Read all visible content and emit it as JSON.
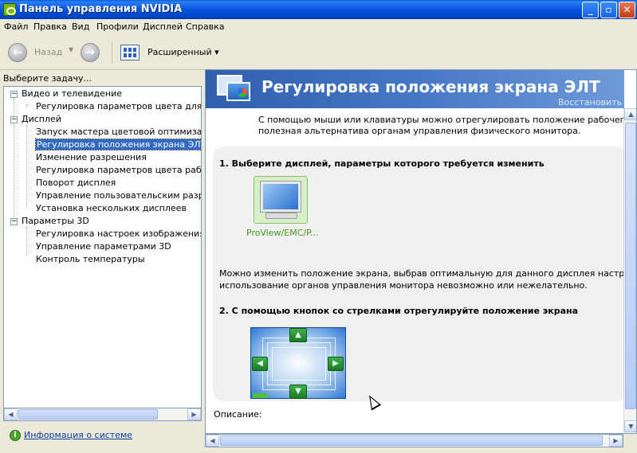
{
  "window": {
    "title": "Панель управления NVIDIA",
    "minimize": "_",
    "maximize": "▫",
    "close": "✕"
  },
  "menu": [
    "Файл",
    "Правка",
    "Вид",
    "Профили",
    "Дисплей",
    "Справка"
  ],
  "toolbar": {
    "back_label": "Назад",
    "view_label": "Расширенный"
  },
  "left": {
    "task_heading": "Выберите задачу...",
    "tree": {
      "video": {
        "label": "Видео и телевидение",
        "children": [
          "Регулировка параметров цвета для вид"
        ]
      },
      "display": {
        "label": "Дисплей",
        "children": [
          "Запуск мастера цветовой оптимизации",
          "Регулировка положения экрана ЭЛТ",
          "Изменение разрешения",
          "Регулировка параметров цвета рабочег",
          "Поворот дисплея",
          "Управление пользовательским разреше",
          "Установка нескольких дисплеев"
        ]
      },
      "p3d": {
        "label": "Параметры 3D",
        "children": [
          "Регулировка настроек изображения с пр",
          "Управление параметрами 3D",
          "Контроль температуры"
        ]
      }
    },
    "system_info_link": "Информация о системе"
  },
  "main": {
    "title": "Регулировка положения экрана ЭЛТ",
    "restore_link": "Восстановить",
    "intro_line1": "С помощью мыши или клавиатуры можно отрегулировать положение рабочего стола на э",
    "intro_line2": "полезная альтернатива органам управления физического монитора.",
    "step1": "1. Выберите дисплей, параметры которого требуется изменить",
    "display_name": "ProView/EMC/P...",
    "para2_line1": "Можно изменить положение экрана, выбрав оптимальную для данного дисплея настройку. Это по",
    "para2_line2": "использование органов управления монитора невозможно или нежелательно.",
    "step2": "2. С помощью кнопок со стрелками отрегулируйте положение экрана",
    "description_label": "Описание:"
  },
  "icons": {
    "back": "arrow-left-icon",
    "forward": "arrow-right-icon",
    "view": "grid-view-icon",
    "system_info": "info-icon",
    "arrow_up": "arrow-up-icon",
    "arrow_down": "arrow-down-icon",
    "arrow_left": "arrow-left-icon",
    "arrow_right": "arrow-right-icon"
  },
  "colors": {
    "selection": "#316ac5",
    "accent_green": "#76b900",
    "banner": "#3e6fbf"
  }
}
